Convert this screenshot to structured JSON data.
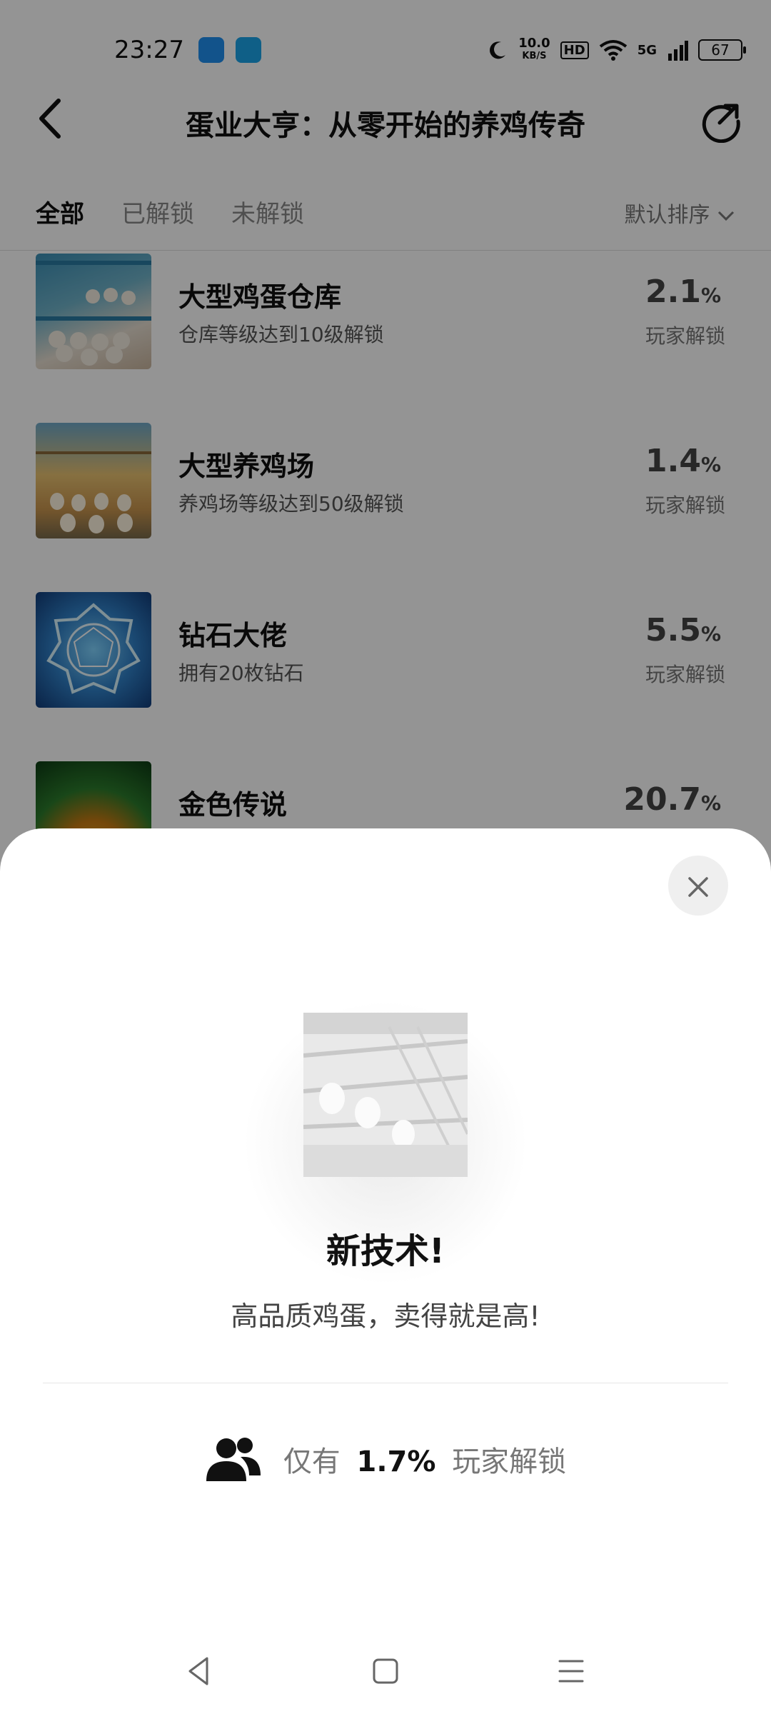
{
  "status_bar": {
    "time": "23:27",
    "speed_top": "10.0",
    "speed_unit": "KB/S",
    "hd": "HD",
    "network": "5G",
    "battery": "67"
  },
  "header": {
    "title": "蛋业大亨：从零开始的养鸡传奇",
    "back_icon": "back-arrow",
    "share_icon": "share-icon"
  },
  "tabs": [
    "全部",
    "已解锁",
    "未解锁"
  ],
  "sort_label": "默认排序",
  "achievements": [
    {
      "name": "大型鸡蛋仓库",
      "desc": "仓库等级达到10级解锁",
      "percent": "2.1",
      "unlock_label": "玩家解锁"
    },
    {
      "name": "大型养鸡场",
      "desc": "养鸡场等级达到50级解锁",
      "percent": "1.4",
      "unlock_label": "玩家解锁"
    },
    {
      "name": "钻石大佬",
      "desc": "拥有20枚钻石",
      "percent": "5.5",
      "unlock_label": "玩家解锁"
    },
    {
      "name": "金色传说",
      "desc": "",
      "percent": "20.7",
      "unlock_label": ""
    }
  ],
  "percent_sign": "%",
  "sheet": {
    "title": "新技术!",
    "description": "高品质鸡蛋，卖得就是高!",
    "rarity_prefix": "仅有",
    "rarity_value": "1.7%",
    "rarity_suffix": "玩家解锁"
  },
  "colors": {
    "overlay": "#000000",
    "sheet_bg": "#ffffff"
  }
}
